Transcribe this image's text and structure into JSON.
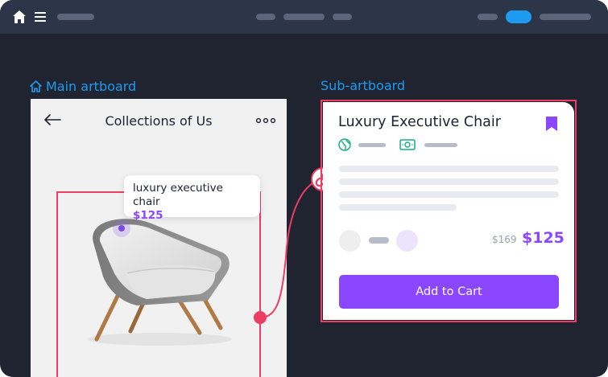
{
  "colors": {
    "accent": "#1e9bf0",
    "selection": "#ee3d62",
    "brand_purple": "#8b46ff",
    "canvas": "#1f2430",
    "toolbar": "#2d3648"
  },
  "toolbar": {
    "icons": [
      "home-icon",
      "menu-icon"
    ]
  },
  "artboards": {
    "main_label": "Main artboard",
    "sub_label": "Sub-artboard"
  },
  "main": {
    "heading": "Collections of Us",
    "tooltip": {
      "name": "luxury executive chair",
      "price": "$125"
    }
  },
  "sub": {
    "title": "Luxury Executive Chair",
    "old_price": "$169",
    "price": "$125",
    "cta": "Add to Cart"
  }
}
